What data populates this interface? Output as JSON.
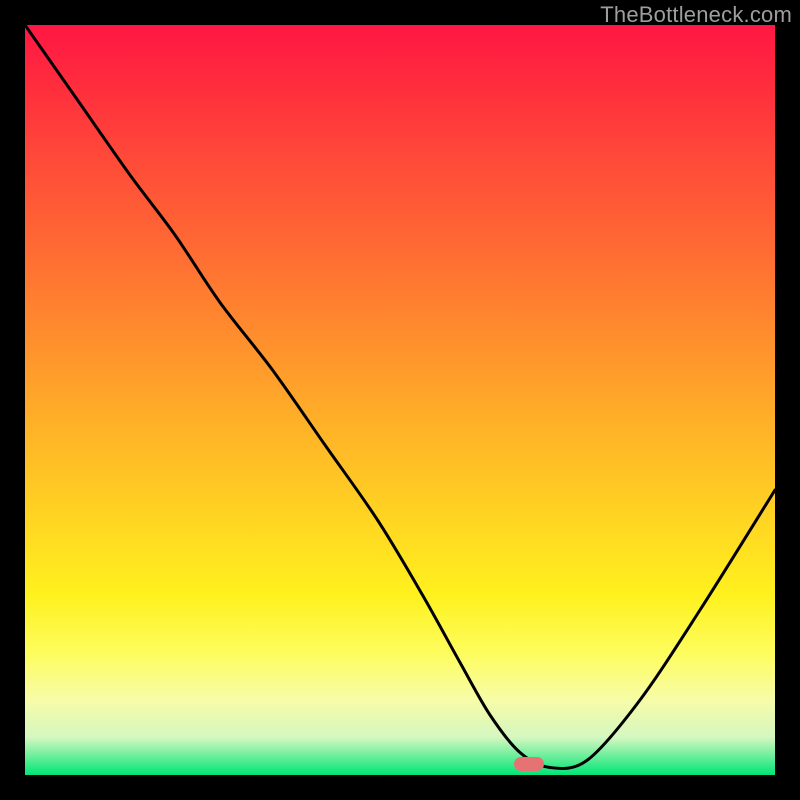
{
  "watermark": "TheBottleneck.com",
  "marker": {
    "x_frac": 0.672,
    "y_frac": 0.985,
    "color": "#e57373"
  },
  "chart_data": {
    "type": "line",
    "title": "",
    "xlabel": "",
    "ylabel": "",
    "xlim": [
      0,
      1
    ],
    "ylim": [
      0,
      1
    ],
    "x": [
      0.0,
      0.07,
      0.14,
      0.2,
      0.26,
      0.33,
      0.4,
      0.47,
      0.53,
      0.58,
      0.62,
      0.66,
      0.7,
      0.75,
      0.82,
      0.9,
      1.0
    ],
    "values": [
      1.0,
      0.9,
      0.8,
      0.72,
      0.63,
      0.54,
      0.44,
      0.34,
      0.24,
      0.15,
      0.08,
      0.03,
      0.01,
      0.02,
      0.1,
      0.22,
      0.38
    ],
    "optimal_x": 0.672
  }
}
